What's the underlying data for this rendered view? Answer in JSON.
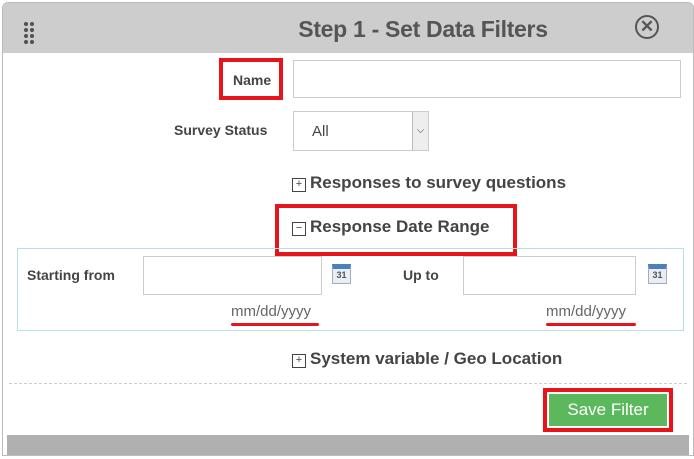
{
  "dialog": {
    "title": "Step 1 - Set Data Filters",
    "close_icon": "⊗"
  },
  "form": {
    "name_label": "Name",
    "name_value": "",
    "status_label": "Survey Status",
    "status_value": "All",
    "responses_section": "Responses to survey questions",
    "date_section": "Response Date Range",
    "start_label": "Starting from",
    "start_value": "",
    "start_hint": "mm/dd/yyyy",
    "end_label": "Up to",
    "end_value": "",
    "end_hint": "mm/dd/yyyy",
    "calendar_text": "31",
    "system_section": "System variable / Geo Location",
    "plus": "+",
    "minus": "−"
  },
  "actions": {
    "save_label": "Save Filter"
  },
  "colors": {
    "highlight": "#e8141c",
    "save": "#5cb85c"
  }
}
